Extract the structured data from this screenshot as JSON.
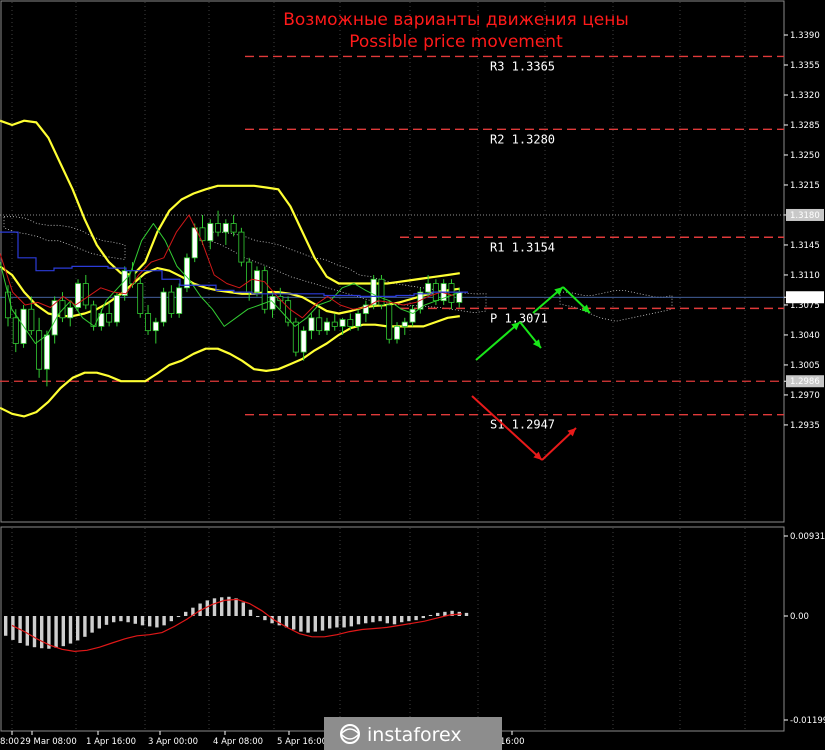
{
  "chart_data": {
    "type": "line",
    "title_ru": "Возможные варианты движения цены",
    "title_en": "Possible price movement",
    "price_axis": {
      "ylim": [
        2928,
        3408
      ],
      "ticks": [
        "1.3390",
        "1.3355",
        "1.3320",
        "1.3285",
        "1.3250",
        "1.3215",
        "1.3180",
        "1.3145",
        "1.3110",
        "1.3084",
        "1.3075",
        "1.3040",
        "1.3005",
        "1.2986",
        "1.2970",
        "1.2935"
      ],
      "highlighted": [
        "1.3180",
        "1.3084",
        "1.2986"
      ]
    },
    "oscillator_axis": {
      "ticks": [
        "0.00931",
        "0.00",
        "-0.01199"
      ]
    },
    "x_ticks": [
      "8:00",
      "29 Mar 08:00",
      "1 Apr 16:00",
      "3 Apr 00:00",
      "4 Apr 08:00",
      "5 Apr 16:00",
      "16:00"
    ],
    "levels": [
      {
        "name": "R3",
        "label": "R3 1.3365",
        "value": 3365
      },
      {
        "name": "R2",
        "label": "R2 1.3280",
        "value": 3280
      },
      {
        "name": "R1",
        "label": "R1 1.3154",
        "value": 3154
      },
      {
        "name": "P",
        "label": "P 1.3071",
        "value": 3071
      },
      {
        "name": "S1",
        "label": "S1 1.2947",
        "value": 2947
      }
    ],
    "candles": [
      [
        3090,
        3098,
        3050,
        3060
      ],
      [
        3060,
        3070,
        3020,
        3030
      ],
      [
        3030,
        3075,
        3025,
        3070
      ],
      [
        3070,
        3085,
        3040,
        3045
      ],
      [
        3045,
        3060,
        2990,
        3000
      ],
      [
        3000,
        3045,
        2980,
        3040
      ],
      [
        3040,
        3085,
        3030,
        3080
      ],
      [
        3080,
        3090,
        3055,
        3060
      ],
      [
        3060,
        3080,
        3050,
        3072
      ],
      [
        3072,
        3105,
        3068,
        3100
      ],
      [
        3100,
        3110,
        3070,
        3075
      ],
      [
        3075,
        3080,
        3045,
        3050
      ],
      [
        3050,
        3070,
        3045,
        3065
      ],
      [
        3065,
        3078,
        3050,
        3055
      ],
      [
        3055,
        3090,
        3050,
        3086
      ],
      [
        3086,
        3120,
        3080,
        3115
      ],
      [
        3115,
        3125,
        3095,
        3100
      ],
      [
        3100,
        3108,
        3060,
        3065
      ],
      [
        3065,
        3075,
        3040,
        3045
      ],
      [
        3045,
        3060,
        3030,
        3055
      ],
      [
        3055,
        3095,
        3050,
        3090
      ],
      [
        3090,
        3098,
        3060,
        3065
      ],
      [
        3065,
        3100,
        3060,
        3095
      ],
      [
        3095,
        3135,
        3090,
        3130
      ],
      [
        3130,
        3170,
        3125,
        3165
      ],
      [
        3165,
        3180,
        3145,
        3150
      ],
      [
        3150,
        3175,
        3140,
        3170
      ],
      [
        3170,
        3185,
        3155,
        3160
      ],
      [
        3160,
        3175,
        3145,
        3170
      ],
      [
        3170,
        3180,
        3155,
        3160
      ],
      [
        3160,
        3165,
        3120,
        3125
      ],
      [
        3125,
        3130,
        3080,
        3090
      ],
      [
        3090,
        3120,
        3085,
        3115
      ],
      [
        3115,
        3120,
        3065,
        3070
      ],
      [
        3070,
        3090,
        3060,
        3085
      ],
      [
        3085,
        3095,
        3070,
        3080
      ],
      [
        3080,
        3085,
        3050,
        3055
      ],
      [
        3055,
        3060,
        3015,
        3020
      ],
      [
        3020,
        3050,
        3010,
        3045
      ],
      [
        3045,
        3065,
        3035,
        3060
      ],
      [
        3060,
        3070,
        3040,
        3045
      ],
      [
        3045,
        3060,
        3040,
        3055
      ],
      [
        3055,
        3065,
        3045,
        3050
      ],
      [
        3050,
        3060,
        3040,
        3058
      ],
      [
        3058,
        3065,
        3045,
        3050
      ],
      [
        3050,
        3070,
        3045,
        3065
      ],
      [
        3065,
        3080,
        3055,
        3075
      ],
      [
        3075,
        3110,
        3070,
        3105
      ],
      [
        3105,
        3110,
        3070,
        3075
      ],
      [
        3075,
        3080,
        3030,
        3035
      ],
      [
        3035,
        3055,
        3030,
        3050
      ],
      [
        3050,
        3060,
        3040,
        3055
      ],
      [
        3055,
        3075,
        3050,
        3070
      ],
      [
        3070,
        3095,
        3065,
        3090
      ],
      [
        3090,
        3110,
        3085,
        3100
      ],
      [
        3100,
        3105,
        3075,
        3080
      ],
      [
        3080,
        3105,
        3075,
        3100
      ],
      [
        3100,
        3105,
        3070,
        3078
      ],
      [
        3078,
        3095,
        3072,
        3090
      ]
    ],
    "bb_upper": [
      3290,
      3285,
      3290,
      3288,
      3270,
      3240,
      3210,
      3175,
      3145,
      3125,
      3112,
      3110,
      3125,
      3160,
      3185,
      3198,
      3205,
      3210,
      3214,
      3214,
      3214,
      3214,
      3212,
      3210,
      3190,
      3160,
      3130,
      3108,
      3100,
      3100,
      3100,
      3100,
      3100,
      3102,
      3104,
      3106,
      3108,
      3110,
      3112
    ],
    "bb_middle": [
      3120,
      3110,
      3090,
      3075,
      3065,
      3062,
      3062,
      3065,
      3070,
      3078,
      3088,
      3100,
      3112,
      3118,
      3115,
      3108,
      3100,
      3095,
      3092,
      3090,
      3088,
      3088,
      3090,
      3090,
      3088,
      3084,
      3076,
      3068,
      3065,
      3068,
      3072,
      3074,
      3075,
      3078,
      3082,
      3086,
      3090,
      3092,
      3094
    ],
    "bb_lower": [
      2955,
      2948,
      2945,
      2950,
      2962,
      2978,
      2990,
      2996,
      2996,
      2992,
      2986,
      2986,
      2986,
      2995,
      3005,
      3010,
      3018,
      3024,
      3024,
      3018,
      3010,
      3000,
      2998,
      3000,
      3006,
      3012,
      3022,
      3030,
      3040,
      3048,
      3052,
      3052,
      3050,
      3050,
      3050,
      3050,
      3055,
      3060,
      3062
    ],
    "ma_red": [
      3135,
      3090,
      3075,
      3078,
      3072,
      3085,
      3075,
      3085,
      3095,
      3090,
      3088,
      3110,
      3125,
      3130,
      3160,
      3180,
      3150,
      3110,
      3100,
      3095,
      3105,
      3102,
      3085,
      3070,
      3060,
      3075,
      3085,
      3075,
      3070,
      3072,
      3080,
      3078,
      3075,
      3078,
      3085,
      3090,
      3086
    ],
    "ma_blue": [
      3160,
      3130,
      3115,
      3118,
      3120,
      3120,
      3118,
      3115,
      3115,
      3105,
      3098,
      3098,
      3092,
      3090,
      3088,
      3088,
      3088,
      3088,
      3086,
      3086,
      3085,
      3085,
      3086,
      3088,
      3090,
      3090
    ],
    "ma_green": [
      3125,
      3070,
      3050,
      3030,
      3040,
      3065,
      3080,
      3060,
      3050,
      3080,
      3095,
      3110,
      3150,
      3170,
      3150,
      3120,
      3105,
      3085,
      3070,
      3050,
      3060,
      3070,
      3075,
      3080,
      3065,
      3050,
      3060,
      3075,
      3080,
      3095,
      3100,
      3092,
      3085,
      3080,
      3070,
      3065,
      3075,
      3080,
      3085,
      3090
    ],
    "hist": [
      -0.0038,
      -0.0046,
      -0.0052,
      -0.0057,
      -0.006,
      -0.0062,
      -0.0063,
      -0.0061,
      -0.0058,
      -0.0053,
      -0.0047,
      -0.004,
      -0.0032,
      -0.0024,
      -0.0017,
      -0.0012,
      -0.001,
      -0.0012,
      -0.0015,
      -0.0018,
      -0.002,
      -0.0022,
      -0.0018,
      -0.001,
      -0.0002,
      0.0008,
      0.0016,
      0.0024,
      0.003,
      0.0034,
      0.0036,
      0.0037,
      0.0034,
      0.0026,
      0.0012,
      -0.0002,
      -0.0008,
      -0.0014,
      -0.0018,
      -0.0022,
      -0.0026,
      -0.003,
      -0.0032,
      -0.003,
      -0.0028,
      -0.0024,
      -0.0022,
      -0.0022,
      -0.002,
      -0.0016,
      -0.0014,
      -0.0012,
      -0.001,
      -0.0014,
      -0.0016,
      -0.0012,
      -0.001,
      -0.0008,
      -0.0004,
      0.0002,
      0.0006,
      0.0008,
      0.001,
      0.0008,
      0.0006
    ],
    "signal": [
      -0.0018,
      -0.003,
      -0.0044,
      -0.0056,
      -0.0064,
      -0.0068,
      -0.0066,
      -0.006,
      -0.0052,
      -0.0044,
      -0.0038,
      -0.0036,
      -0.0032,
      -0.002,
      -0.0006,
      0.001,
      0.0022,
      0.003,
      0.0032,
      0.0024,
      0.001,
      -0.0008,
      -0.0022,
      -0.0034,
      -0.004,
      -0.004,
      -0.0036,
      -0.003,
      -0.0026,
      -0.0024,
      -0.0022,
      -0.0018,
      -0.0014,
      -0.001,
      -0.0004,
      0.0002,
      0.0004
    ]
  },
  "watermark": "instaforex"
}
